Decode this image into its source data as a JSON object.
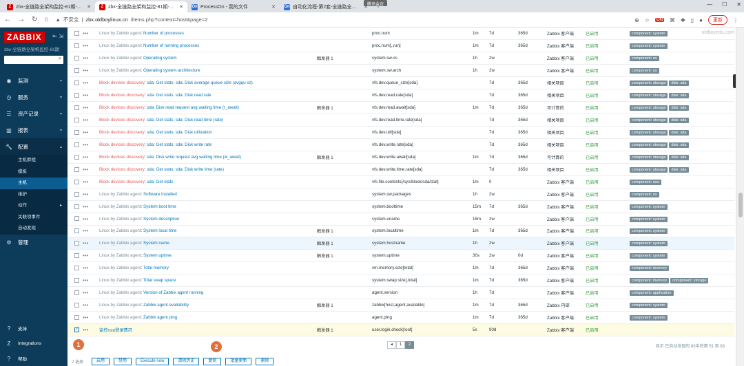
{
  "browser": {
    "tabs": [
      {
        "icon": "Z",
        "color": "#d40000",
        "title": "zbx-全链路全架构监控-81期-配置..",
        "active": false
      },
      {
        "icon": "Z",
        "color": "#d40000",
        "title": "zbx-全链路全架构监控-81期-配置..",
        "active": true
      },
      {
        "icon": "On",
        "color": "#2f6fd6",
        "title": "ProcessOn - 我的文件",
        "active": false
      },
      {
        "icon": "On",
        "color": "#2f6fd6",
        "title": "自动化流程-第2套-全链路全架构..",
        "active": false
      }
    ],
    "meeting_badge": "腾讯会议",
    "insecure_label": "不安全",
    "url_host": "zbx.oldboylinux.cn",
    "url_path": "/items.php?context=host&page=2",
    "update_label": "更新",
    "ext_badge": "ON"
  },
  "sidebar": {
    "logo": "ZABBIX",
    "subtitle": "zbx-全链路全架构监控-81期",
    "menu": [
      {
        "label": "监测",
        "icon": "eye-icon",
        "glyph": "◉"
      },
      {
        "label": "服务",
        "icon": "clock-icon",
        "glyph": "◷"
      },
      {
        "label": "资产记录",
        "icon": "list-icon",
        "glyph": "☰"
      },
      {
        "label": "报表",
        "icon": "chart-icon",
        "glyph": "▥"
      },
      {
        "label": "配置",
        "icon": "wrench-icon",
        "glyph": "🔧"
      }
    ],
    "submenu": [
      {
        "label": "主机群组",
        "arrow": ""
      },
      {
        "label": "模板",
        "arrow": ""
      },
      {
        "label": "主机",
        "arrow": ""
      },
      {
        "label": "维护",
        "arrow": ""
      },
      {
        "label": "动作",
        "arrow": "▸"
      },
      {
        "label": "关联项事件",
        "arrow": ""
      },
      {
        "label": "自动发现",
        "arrow": ""
      }
    ],
    "admin": {
      "label": "管理",
      "glyph": "⚙"
    },
    "bottom": [
      {
        "label": "支持",
        "glyph": "?"
      },
      {
        "label": "Integrations",
        "glyph": "Z"
      },
      {
        "label": "帮助",
        "glyph": "?"
      }
    ]
  },
  "watermark": "oldboyedu.com",
  "rows": [
    {
      "pre": "Linux by Zabbix agent",
      "pretype": "linux",
      "name": "Number of processes",
      "trig": "",
      "key": "proc.num",
      "interval": "1m",
      "history": "7d",
      "trends": "365d",
      "type": "Zabbix 客户端",
      "status": "已启用",
      "tags": [
        "component: system"
      ]
    },
    {
      "pre": "Linux by Zabbix agent",
      "pretype": "linux",
      "name": "Number of running processes",
      "trig": "",
      "key": "proc.num[,,run]",
      "interval": "1m",
      "history": "7d",
      "trends": "365d",
      "type": "Zabbix 客户端",
      "status": "已启用",
      "tags": [
        "component: system"
      ]
    },
    {
      "pre": "Linux by Zabbix agent",
      "pretype": "linux",
      "name": "Operating system",
      "trig": "触发器 1",
      "key": "system.sw.os",
      "interval": "1h",
      "history": "2w",
      "trends": "",
      "type": "Zabbix 客户端",
      "status": "已启用",
      "tags": [
        "component: os"
      ]
    },
    {
      "pre": "Linux by Zabbix agent",
      "pretype": "linux",
      "name": "Operating system architecture",
      "trig": "",
      "key": "system.sw.arch",
      "interval": "1h",
      "history": "2w",
      "trends": "",
      "type": "Zabbix 客户端",
      "status": "已启用",
      "tags": [
        "component: os"
      ]
    },
    {
      "pre": "Block devices discovery",
      "pretype": "block",
      "name": "sda: Get stats: sda: Disk average queue size (avgqu-sz)",
      "trig": "",
      "key": "vfs.dev.queue_size[sda]",
      "interval": "",
      "history": "7d",
      "trends": "365d",
      "type": "相关项目",
      "status": "已启用",
      "tags": [
        "component: storage",
        "disk: sda"
      ]
    },
    {
      "pre": "Block devices discovery",
      "pretype": "block",
      "name": "sda: Get stats: sda: Disk read rate",
      "trig": "",
      "key": "vfs.dev.read.rate[sda]",
      "interval": "",
      "history": "7d",
      "trends": "365d",
      "type": "相关项目",
      "status": "已启用",
      "tags": [
        "component: storage",
        "disk: sda"
      ]
    },
    {
      "pre": "Block devices discovery",
      "pretype": "block",
      "name": "sda: Disk read request avg waiting time (r_await)",
      "trig": "触发器 1",
      "key": "vfs.dev.read.await[sda]",
      "interval": "1m",
      "history": "7d",
      "trends": "365d",
      "type": "可计算的",
      "status": "已启用",
      "tags": [
        "component: storage",
        "disk: sda"
      ]
    },
    {
      "pre": "Block devices discovery",
      "pretype": "block",
      "name": "sda: Get stats: sda: Disk read time (rate)",
      "trig": "",
      "key": "vfs.dev.read.time.rate[sda]",
      "interval": "",
      "history": "7d",
      "trends": "365d",
      "type": "相关项目",
      "status": "已启用",
      "tags": [
        "component: storage",
        "disk: sda"
      ]
    },
    {
      "pre": "Block devices discovery",
      "pretype": "block",
      "name": "sda: Get stats: sda: Disk utilization",
      "trig": "",
      "key": "vfs.dev.util[sda]",
      "interval": "",
      "history": "7d",
      "trends": "365d",
      "type": "相关项目",
      "status": "已启用",
      "tags": [
        "component: storage",
        "disk: sda"
      ]
    },
    {
      "pre": "Block devices discovery",
      "pretype": "block",
      "name": "sda: Get stats: sda: Disk write rate",
      "trig": "",
      "key": "vfs.dev.write.rate[sda]",
      "interval": "",
      "history": "7d",
      "trends": "365d",
      "type": "相关项目",
      "status": "已启用",
      "tags": [
        "component: storage",
        "disk: sda"
      ]
    },
    {
      "pre": "Block devices discovery",
      "pretype": "block",
      "name": "sda: Disk write request avg waiting time (w_await)",
      "trig": "触发器 1",
      "key": "vfs.dev.write.await[sda]",
      "interval": "1m",
      "history": "7d",
      "trends": "365d",
      "type": "可计算的",
      "status": "已启用",
      "tags": [
        "component: storage",
        "disk: sda"
      ]
    },
    {
      "pre": "Block devices discovery",
      "pretype": "block",
      "name": "sda: Get stats: sda: Disk write time (rate)",
      "trig": "",
      "key": "vfs.dev.write.time.rate[sda]",
      "interval": "",
      "history": "7d",
      "trends": "365d",
      "type": "相关项目",
      "status": "已启用",
      "tags": [
        "component: storage",
        "disk: sda"
      ]
    },
    {
      "pre": "Block devices discovery",
      "pretype": "block",
      "name": "sda: Get stats",
      "trig": "",
      "key": "vfs.file.contents[/sys/block/sda/stat]",
      "interval": "1m",
      "history": "0",
      "trends": "",
      "type": "Zabbix 客户端",
      "status": "已启用",
      "tags": [
        "component: raw"
      ]
    },
    {
      "pre": "Linux by Zabbix agent",
      "pretype": "linux",
      "name": "Software installed",
      "trig": "",
      "key": "system.sw.packages",
      "interval": "1h",
      "history": "2w",
      "trends": "",
      "type": "Zabbix 客户端",
      "status": "已启用",
      "tags": [
        "component: os"
      ]
    },
    {
      "pre": "Linux by Zabbix agent",
      "pretype": "linux",
      "name": "System boot time",
      "trig": "",
      "key": "system.boottime",
      "interval": "15m",
      "history": "7d",
      "trends": "365d",
      "type": "Zabbix 客户端",
      "status": "已启用",
      "tags": [
        "component: system"
      ]
    },
    {
      "pre": "Linux by Zabbix agent",
      "pretype": "linux",
      "name": "System description",
      "trig": "",
      "key": "system.uname",
      "interval": "15m",
      "history": "2w",
      "trends": "",
      "type": "Zabbix 客户端",
      "status": "已启用",
      "tags": [
        "component: system"
      ]
    },
    {
      "pre": "Linux by Zabbix agent",
      "pretype": "linux",
      "name": "System local time",
      "trig": "触发器 1",
      "key": "system.localtime",
      "interval": "1m",
      "history": "7d",
      "trends": "365d",
      "type": "Zabbix 客户端",
      "status": "已启用",
      "tags": [
        "component: system"
      ]
    },
    {
      "pre": "Linux by Zabbix agent",
      "pretype": "linux",
      "name": "System name",
      "trig": "触发器 1",
      "key": "system.hostname",
      "interval": "1h",
      "history": "2w",
      "trends": "",
      "type": "Zabbix 客户端",
      "status": "已启用",
      "tags": [
        "component: system"
      ],
      "hover": true
    },
    {
      "pre": "Linux by Zabbix agent",
      "pretype": "linux",
      "name": "System uptime",
      "trig": "触发器 1",
      "key": "system.uptime",
      "interval": "30s",
      "history": "2w",
      "trends": "0d",
      "type": "Zabbix 客户端",
      "status": "已启用",
      "tags": [
        "component: system"
      ]
    },
    {
      "pre": "Linux by Zabbix agent",
      "pretype": "linux",
      "name": "Total memory",
      "trig": "",
      "key": "vm.memory.size[total]",
      "interval": "1m",
      "history": "7d",
      "trends": "365d",
      "type": "Zabbix 客户端",
      "status": "已启用",
      "tags": [
        "component: memory"
      ]
    },
    {
      "pre": "Linux by Zabbix agent",
      "pretype": "linux",
      "name": "Total swap space",
      "trig": "",
      "key": "system.swap.size[,total]",
      "interval": "1m",
      "history": "7d",
      "trends": "365d",
      "type": "Zabbix 客户端",
      "status": "已启用",
      "tags": [
        "component: memory",
        "component: storage"
      ]
    },
    {
      "pre": "Linux by Zabbix agent",
      "pretype": "linux",
      "name": "Version of Zabbix agent running",
      "trig": "",
      "key": "agent.version",
      "interval": "1h",
      "history": "7d",
      "trends": "",
      "type": "Zabbix 客户端",
      "status": "已启用",
      "tags": [
        "component: application"
      ]
    },
    {
      "pre": "Linux by Zabbix agent",
      "pretype": "linux",
      "name": "Zabbix agent availability",
      "trig": "触发器 1",
      "key": "zabbix[host,agent,available]",
      "interval": "1m",
      "history": "7d",
      "trends": "365d",
      "type": "Zabbix 内部",
      "status": "已启用",
      "tags": [
        "component: system"
      ]
    },
    {
      "pre": "Linux by Zabbix agent",
      "pretype": "linux",
      "name": "Zabbix agent ping",
      "trig": "",
      "key": "agent.ping",
      "interval": "1m",
      "history": "7d",
      "trends": "365d",
      "type": "Zabbix 客户端",
      "status": "已启用",
      "tags": [
        "component: system"
      ]
    },
    {
      "pre": "",
      "pretype": "none",
      "name": "监控root登录情况",
      "trig": "触发器 1",
      "key": "user.login.check[root]",
      "interval": "5s",
      "history": "90d",
      "trends": "",
      "type": "Zabbix 客户端",
      "status": "已启用",
      "tags": [],
      "checked": true
    }
  ],
  "pager": {
    "prev": "◂",
    "pages": [
      "1",
      "2"
    ],
    "current": "2"
  },
  "count_text": "显示 已自动发现的 83中的第 51 到 83",
  "actions": {
    "selected": "2 选择",
    "buttons": [
      "启用",
      "禁用",
      "Execute now",
      "清除历史",
      "复制",
      "批量更新",
      "删除"
    ]
  },
  "markers": [
    "1",
    "2"
  ]
}
